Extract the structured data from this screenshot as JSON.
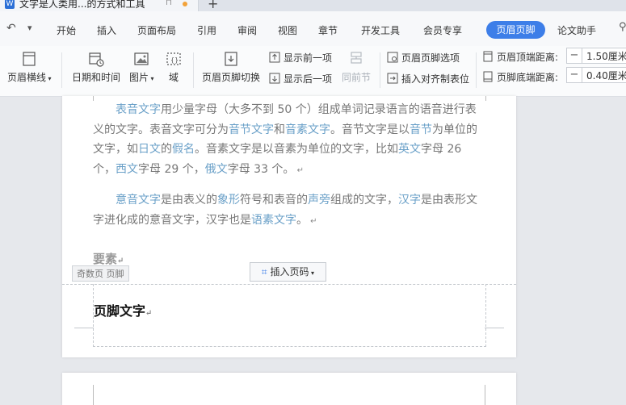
{
  "window": {
    "doc_tab_title": "文字是人类用...的方式和工具",
    "doc_icon_letter": "W",
    "new_tab_symbol": "+"
  },
  "menu": {
    "undo_symbol": "↶",
    "more_symbol": "▾",
    "items": [
      "开始",
      "插入",
      "页面布局",
      "引用",
      "审阅",
      "视图",
      "章节",
      "开发工具",
      "会员专享"
    ],
    "active": "页眉页脚",
    "after_active": "论文助手"
  },
  "ribbon": {
    "header_line": "页眉横线",
    "date_time": "日期和时间",
    "picture": "图片",
    "field": "域",
    "switch_hf": "页眉页脚切换",
    "show_prev": "显示前一项",
    "show_next": "显示后一项",
    "same_prev": "同前节",
    "hf_options": "页眉页脚选项",
    "insert_align_tab": "插入对齐制表位",
    "header_top_label": "页眉顶端距离:",
    "header_top_value": "1.50厘米",
    "footer_bottom_label": "页脚底端距离:",
    "footer_bottom_value": "0.40厘米"
  },
  "document": {
    "p1_segments": [
      {
        "t": "表音文字",
        "h": true
      },
      {
        "t": "用少量字母（大多不到 50 个）组成单词记录语言的语音进行表义的文字。表音文字可分为",
        "h": false
      },
      {
        "t": "音节文字",
        "h": true
      },
      {
        "t": "和",
        "h": false
      },
      {
        "t": "音素文字",
        "h": true
      },
      {
        "t": "。音节文字是以",
        "h": false
      },
      {
        "t": "音节",
        "h": true
      },
      {
        "t": "为单位的文字，如",
        "h": false
      },
      {
        "t": "日文",
        "h": true
      },
      {
        "t": "的",
        "h": false
      },
      {
        "t": "假名",
        "h": true
      },
      {
        "t": "。音素文字是以音素为单位的文字，比如",
        "h": false
      },
      {
        "t": "英文",
        "h": true
      },
      {
        "t": "字母 26 个，",
        "h": false
      },
      {
        "t": "西文",
        "h": true
      },
      {
        "t": "字母 29 个，",
        "h": false
      },
      {
        "t": "俄文",
        "h": true
      },
      {
        "t": "字母 33 个。",
        "h": false
      }
    ],
    "p2_segments": [
      {
        "t": "意音文字",
        "h": true
      },
      {
        "t": "是由表义的",
        "h": false
      },
      {
        "t": "象形",
        "h": true
      },
      {
        "t": "符号和表音的",
        "h": false
      },
      {
        "t": "声旁",
        "h": true
      },
      {
        "t": "组成的文字，",
        "h": false
      },
      {
        "t": "汉字",
        "h": true
      },
      {
        "t": "是由表形文字进化成的意音文字，汉字也是",
        "h": false
      },
      {
        "t": "语素文字",
        "h": true
      },
      {
        "t": "。",
        "h": false
      }
    ],
    "return_mark": "↵",
    "heading": "要素",
    "footer_tag": "奇数页 页脚",
    "insert_page_number": "插入页码",
    "footer_text": "页脚文字"
  },
  "colors": {
    "accent": "#3d7ee8",
    "link_text": "#6aa0c8"
  }
}
